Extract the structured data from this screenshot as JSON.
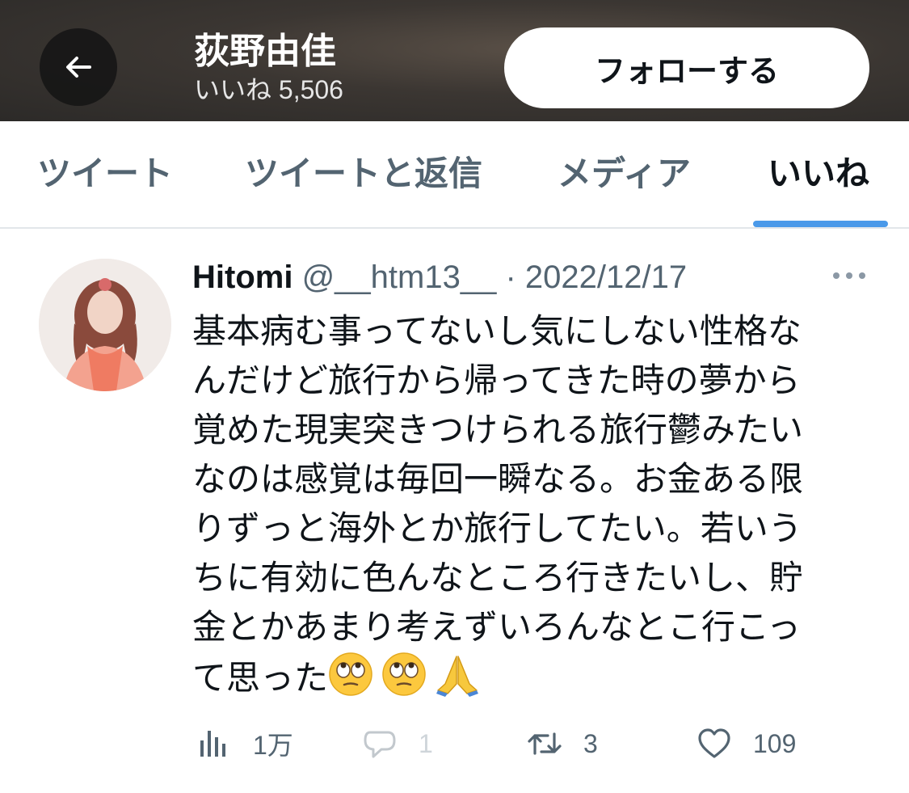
{
  "header": {
    "back_icon": "arrow-left-icon",
    "profile_name": "荻野由佳",
    "likes_count": "いいね 5,506",
    "follow_label": "フォローする"
  },
  "tabs": [
    {
      "label": "ツイート",
      "active": false
    },
    {
      "label": "ツイートと返信",
      "active": false
    },
    {
      "label": "メディア",
      "active": false
    },
    {
      "label": "いいね",
      "active": true
    }
  ],
  "colors": {
    "accent": "#4a99e9",
    "text_primary": "#0f1419",
    "text_secondary": "#536471"
  },
  "tweet": {
    "author": "Hitomi",
    "handle": "@__htm13__",
    "separator": "·",
    "date": "2022/12/17",
    "more_icon": "more-dots-icon",
    "text_lines": [
      "基本病む事ってないし気にしない性格な",
      "んだけど旅行から帰ってきた時の夢から",
      "覚めた現実突きつけられる旅行鬱みたい",
      "なのは感覚は毎回一瞬なる。お金ある限",
      "りずっと海外とか旅行してたい。若いう",
      "ちに有効に色んなところ行きたいし、貯",
      "金とかあまり考えずいろんなとこ行こっ",
      "て思った"
    ],
    "emojis": [
      "face-with-rolling-eyes-emoji",
      "face-with-rolling-eyes-emoji",
      "folded-hands-emoji"
    ],
    "actions": {
      "views": {
        "icon": "analytics-icon",
        "count": "1万"
      },
      "reply": {
        "icon": "reply-icon",
        "count": "1"
      },
      "retweet": {
        "icon": "retweet-icon",
        "count": "3"
      },
      "like": {
        "icon": "heart-icon",
        "count": "109"
      }
    }
  }
}
